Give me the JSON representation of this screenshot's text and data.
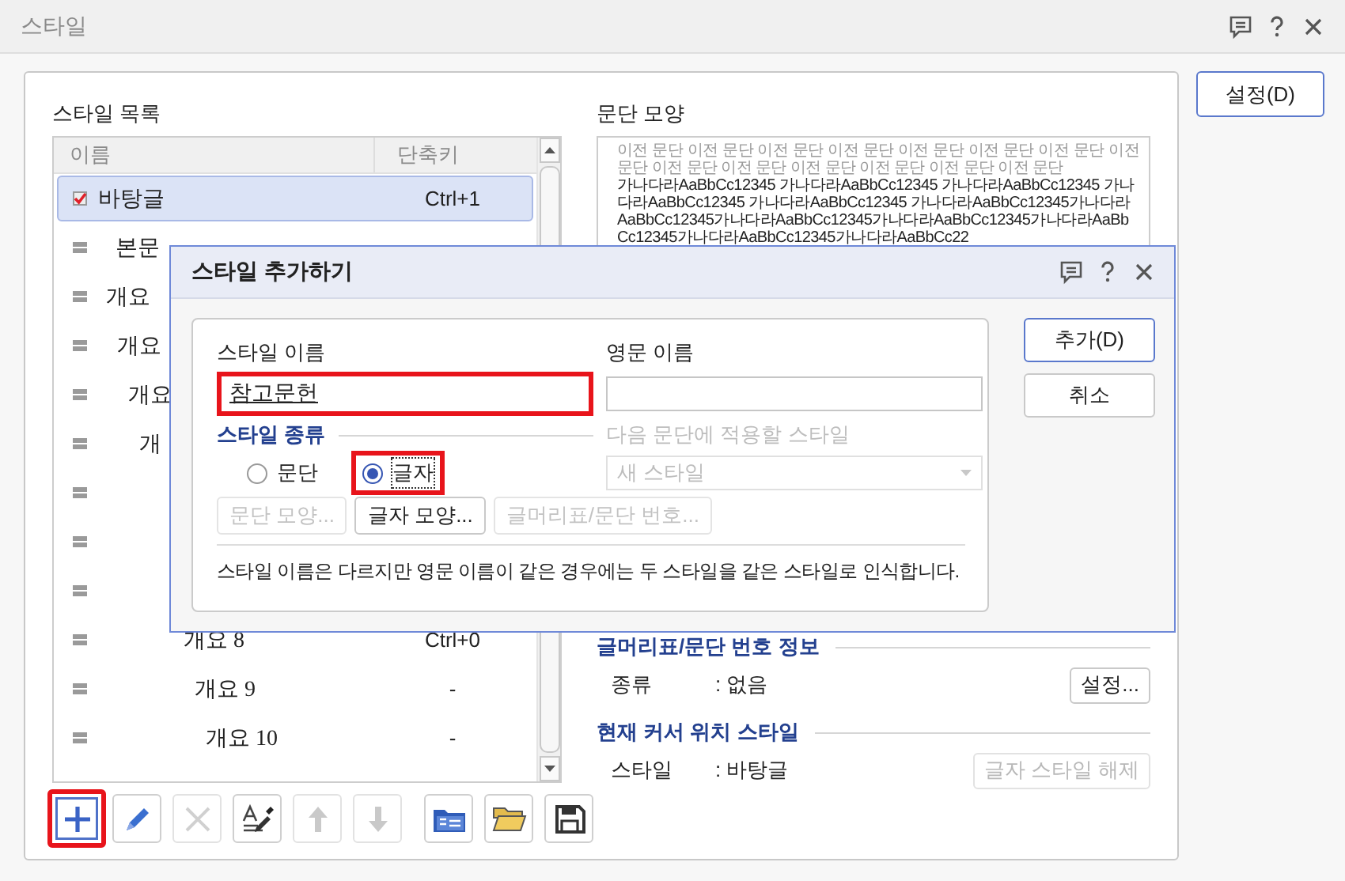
{
  "window": {
    "title": "스타일"
  },
  "settings_button": "설정(D)",
  "style_list": {
    "title": "스타일 목록",
    "columns": [
      "이름",
      "단축키"
    ],
    "rows": [
      {
        "name": "바탕글",
        "shortcut": "Ctrl+1",
        "selected": true
      },
      {
        "name": "본문",
        "selected": false
      },
      {
        "name": "개요",
        "selected": false
      },
      {
        "name": "개요",
        "selected": false
      },
      {
        "name": "개요",
        "selected": false
      },
      {
        "name": "개",
        "selected": false
      },
      {
        "selected": false
      },
      {
        "selected": false
      },
      {
        "selected": false
      },
      {
        "name": "개요 8",
        "shortcut": "Ctrl+0",
        "selected": false
      },
      {
        "name": "개요 9",
        "shortcut": "-",
        "selected": false
      },
      {
        "name": "개요 10",
        "shortcut": "-",
        "selected": false
      }
    ]
  },
  "preview": {
    "title": "문단 모양",
    "previous_text": "이전 문단 이전 문단 이전 문단 이전 문단 이전 문단 이전 문단 이전 문단 이전 문단 이전 문단 이전 문단 이전 문단 이전 문단 이전 문단 이전 문단",
    "sample_text": "가나다라AaBbCc12345 가나다라AaBbCc12345 가나다라AaBbCc12345 가나다라AaBbCc12345 가나다라AaBbCc12345 가나다라AaBbCc12345가나다라AaBbCc12345가나다라AaBbCc12345가나다라AaBbCc12345가나다라AaBbCc12345가나다라AaBbCc12345가나다라AaBbCc22"
  },
  "numbering_info": {
    "title": "글머리표/문단 번호 정보",
    "label": "종류",
    "value": ": 없음",
    "button": {
      "label": "설정...",
      "disabled": false
    }
  },
  "cursor_style": {
    "title": "현재 커서 위치 스타일",
    "label": "스타일",
    "value": ": 바탕글",
    "button": {
      "label": "글자 스타일 해제",
      "disabled": true
    }
  },
  "toolbar": [
    [
      {
        "kind": "add",
        "disabled": false,
        "highlighted": true
      },
      {
        "kind": "edit",
        "disabled": false,
        "highlighted": false
      },
      {
        "kind": "delete",
        "disabled": true,
        "highlighted": false
      },
      {
        "kind": "eyedropper",
        "disabled": false,
        "highlighted": false
      },
      {
        "kind": "up",
        "disabled": true,
        "highlighted": false
      },
      {
        "kind": "down",
        "disabled": true,
        "highlighted": false
      }
    ],
    [
      {
        "kind": "import",
        "disabled": false,
        "highlighted": false
      },
      {
        "kind": "open",
        "disabled": false,
        "highlighted": false
      },
      {
        "kind": "save",
        "disabled": false,
        "highlighted": false
      }
    ]
  ],
  "dialog": {
    "title": "스타일 추가하기",
    "name_label": "스타일 이름",
    "name_value": "참고문헌",
    "name_highlighted": true,
    "english_label": "영문 이름",
    "type_title": "스타일 종류",
    "types": [
      {
        "label": "문단",
        "selected": false,
        "highlighted": false
      },
      {
        "label": "글자",
        "selected": true,
        "highlighted": true
      }
    ],
    "next_label": "다음 문단에 적용할 스타일",
    "next_style": {
      "value": "새 스타일",
      "disabled": true
    },
    "buttons": [
      {
        "label": "문단 모양...",
        "disabled": true
      },
      {
        "label": "글자 모양...",
        "disabled": false
      },
      {
        "label": "글머리표/문단 번호...",
        "disabled": true
      }
    ],
    "note": "스타일 이름은 다르지만 영문 이름이 같은 경우에는 두 스타일을 같은 스타일로 인식합니다.",
    "actions": [
      {
        "label": "추가(D)",
        "default": true
      },
      {
        "label": "취소",
        "default": false
      }
    ]
  }
}
